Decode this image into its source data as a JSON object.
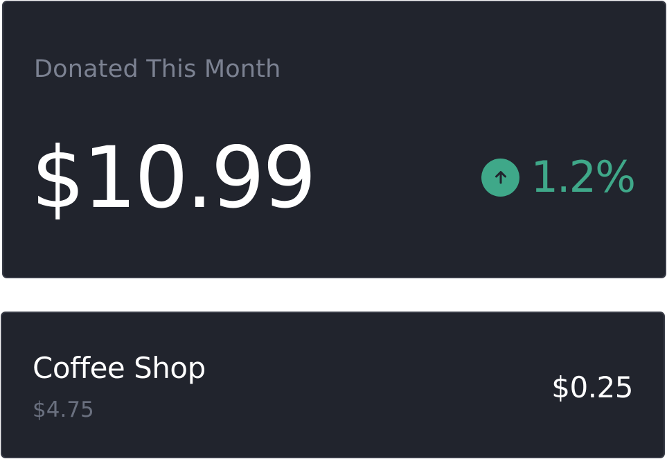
{
  "summary": {
    "label": "Donated This Month",
    "amount": "$10.99",
    "change": {
      "direction": "up",
      "icon": "arrow-up-circle-icon",
      "value": "1.2%",
      "color": "#3fa889"
    }
  },
  "transactions": [
    {
      "merchant": "Coffee Shop",
      "purchase_amount": "$4.75",
      "donation": "$0.25"
    }
  ],
  "colors": {
    "card_background": "#21242d",
    "card_border": "#383b46",
    "primary_text": "#ffffff",
    "muted_text": "#7c8292",
    "positive": "#3fa889"
  }
}
